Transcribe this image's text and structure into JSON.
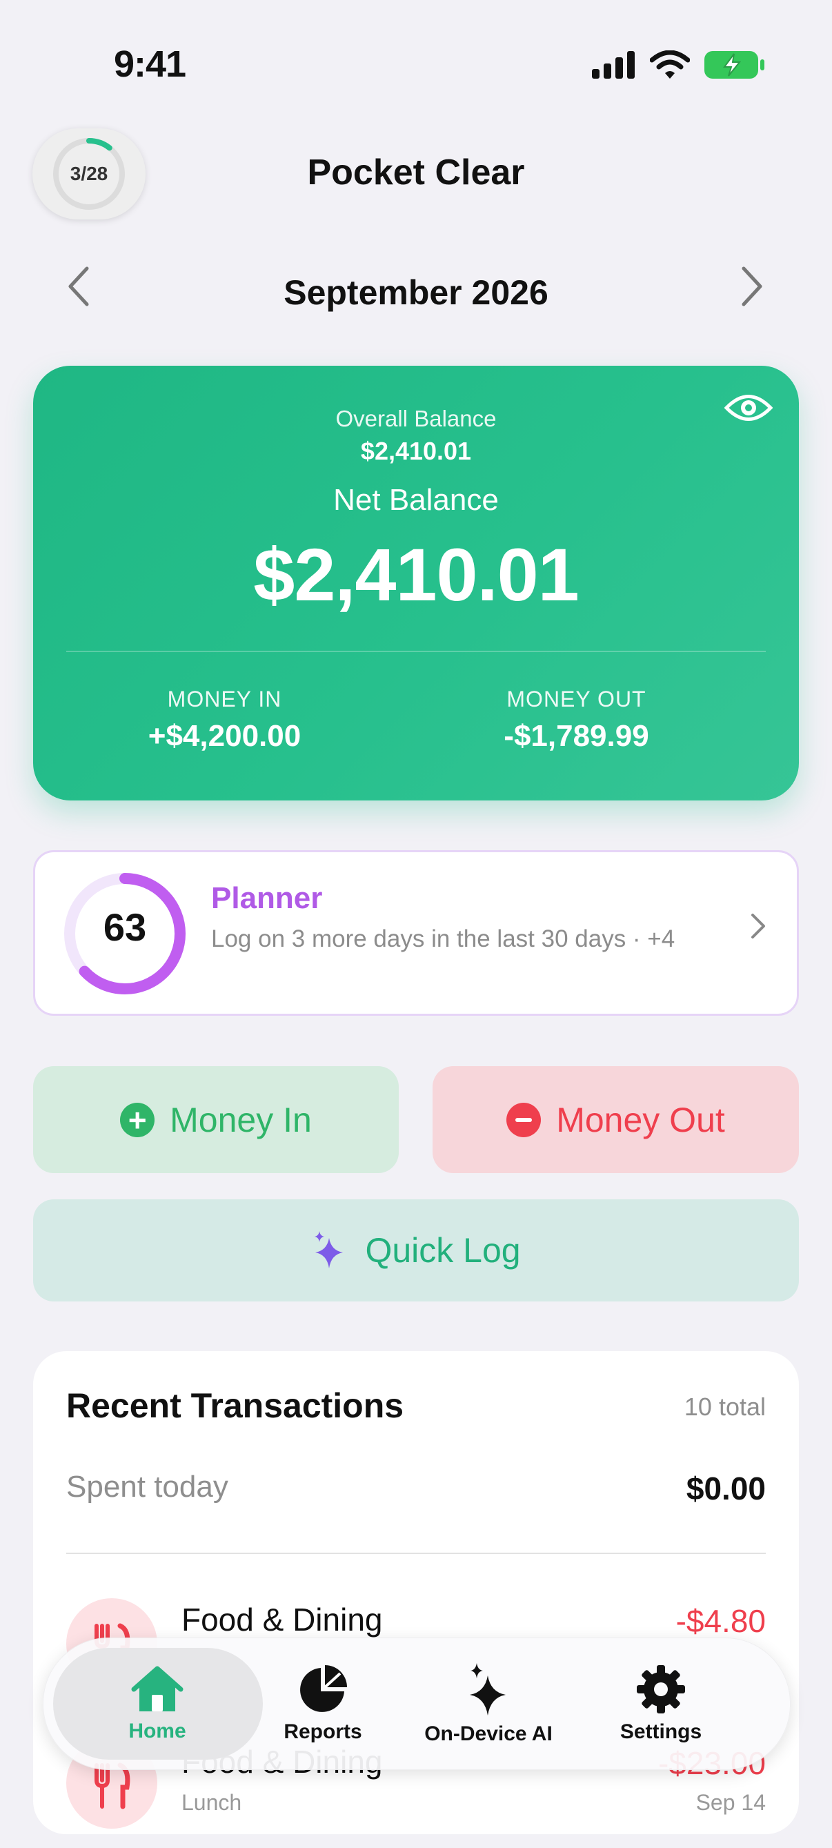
{
  "status_bar": {
    "time": "9:41"
  },
  "header": {
    "progress_label": "3/28",
    "title": "Pocket Clear"
  },
  "month_nav": {
    "label": "September 2026"
  },
  "balance_card": {
    "overall_label": "Overall Balance",
    "overall_value": "$2,410.01",
    "net_label": "Net Balance",
    "net_value": "$2,410.01",
    "money_in_label": "MONEY IN",
    "money_in_value": "+$4,200.00",
    "money_out_label": "MONEY OUT",
    "money_out_value": "-$1,789.99"
  },
  "planner": {
    "score": "63",
    "score_fraction": 0.63,
    "title": "Planner",
    "description": "Log on 3 more days in the last 30 days · +4"
  },
  "actions": {
    "money_in": "Money In",
    "money_out": "Money Out",
    "quick_log": "Quick Log"
  },
  "transactions": {
    "title": "Recent Transactions",
    "total": "10 total",
    "spent_today_label": "Spent today",
    "spent_today_value": "$0.00",
    "items": [
      {
        "name": "Food & Dining",
        "amount": "-$4.80",
        "icon": "fork-knife-icon"
      },
      {
        "name": "Food & Dining",
        "amount": "-$23.00",
        "sub": "Lunch",
        "date": "Sep 14",
        "icon": "fork-knife-icon"
      }
    ]
  },
  "tabbar": {
    "tabs": [
      {
        "label": "Home",
        "icon": "house-icon",
        "active": true
      },
      {
        "label": "Reports",
        "icon": "pie-chart-icon"
      },
      {
        "label": "On-Device AI",
        "icon": "sparkles-icon"
      },
      {
        "label": "Settings",
        "icon": "gear-icon"
      }
    ]
  },
  "colors": {
    "accent_green": "#27c08d",
    "money_in_green": "#2fb568",
    "money_out_red": "#ef3f4d",
    "planner_purple": "#b05ae6"
  }
}
